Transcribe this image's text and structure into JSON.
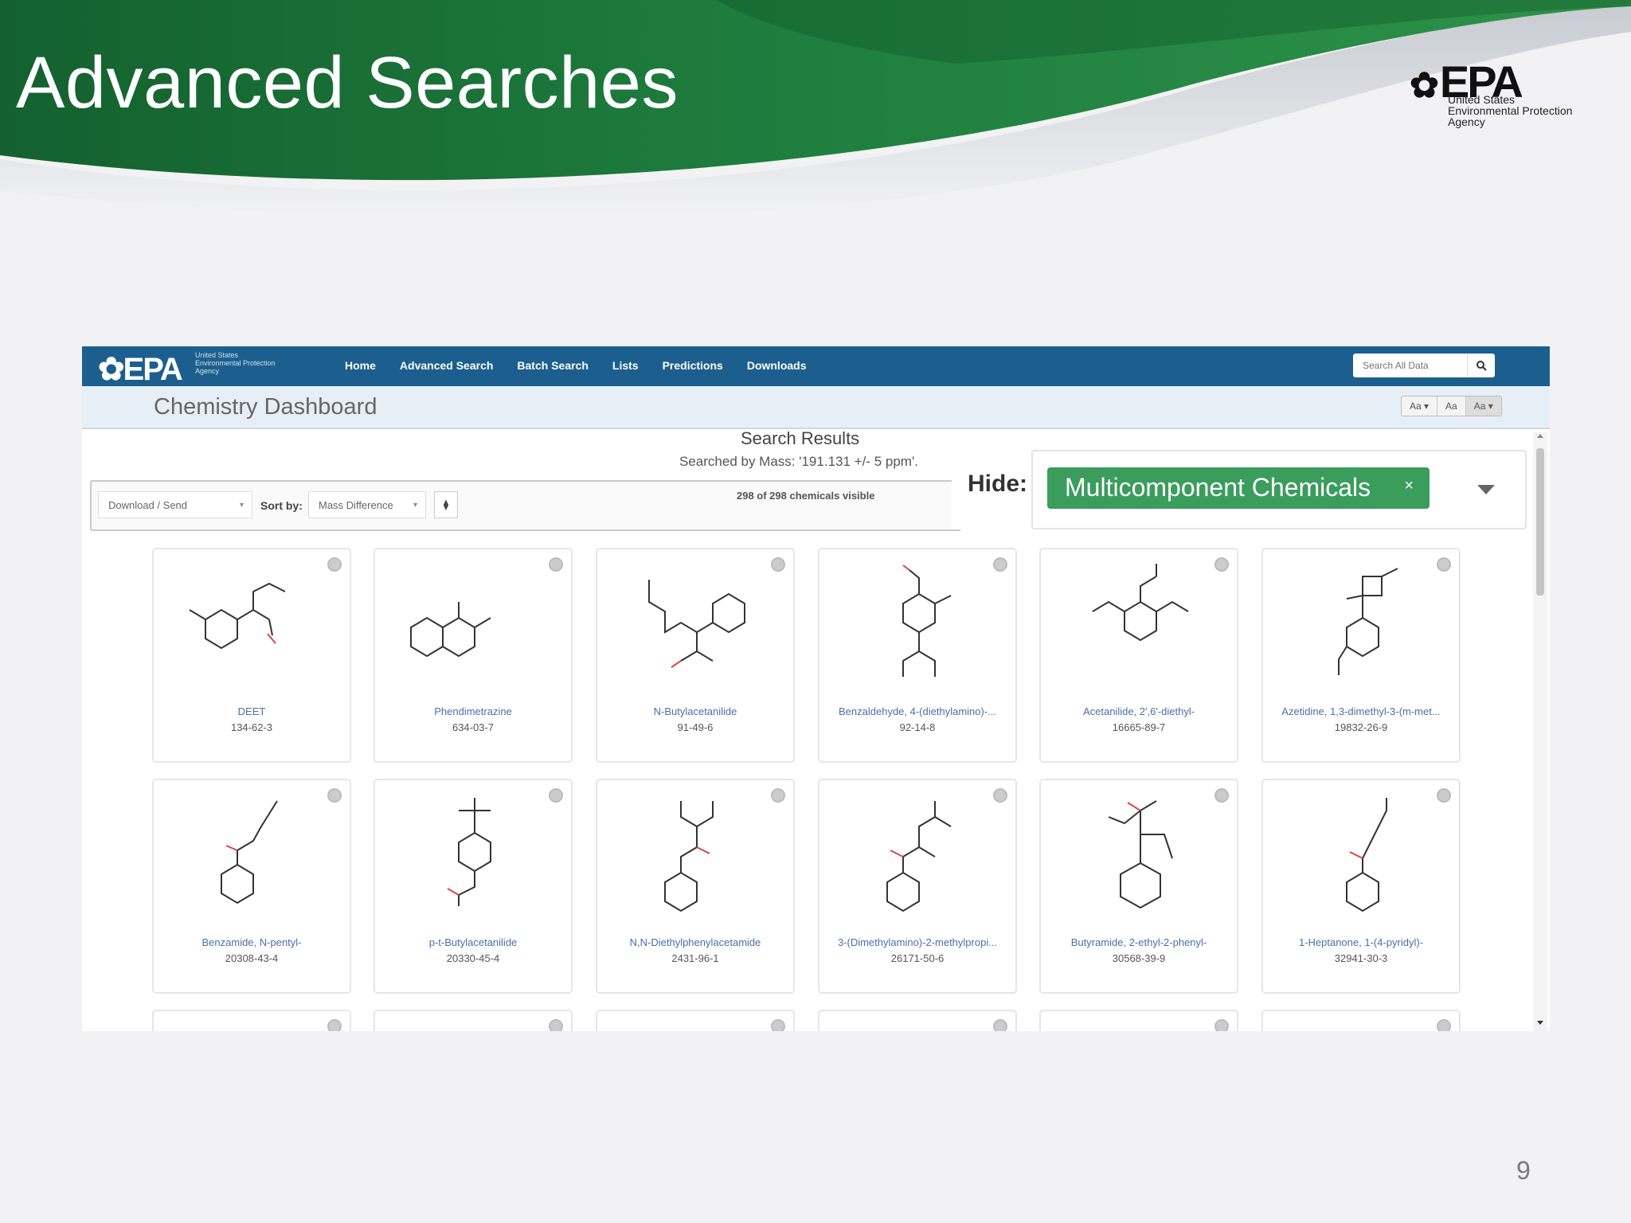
{
  "slide": {
    "title": "Advanced Searches",
    "logo_text": "EPA",
    "logo_agency": "United States\nEnvironmental Protection\nAgency",
    "page_number": "9"
  },
  "app": {
    "brand": "EPA",
    "brand_sub": "United States\nEnvironmental Protection\nAgency",
    "nav_items": [
      "Home",
      "Advanced Search",
      "Batch Search",
      "Lists",
      "Predictions",
      "Downloads"
    ],
    "search_placeholder": "Search All Data",
    "dashboard_title": "Chemistry Dashboard",
    "font_sizes": [
      "Aa ▾",
      "Aa",
      "Aa ▾"
    ]
  },
  "results": {
    "title": "Search Results",
    "subtitle": "Searched by Mass: '191.131 +/- 5 ppm'.",
    "download_label": "Download / Send",
    "sort_label": "Sort by:",
    "sort_value": "Mass Difference",
    "visible_count": "298 of 298 chemicals visible"
  },
  "hide": {
    "label": "Hide:",
    "tag": "Multicomponent Chemicals",
    "tag_remove": "×"
  },
  "chemicals": [
    {
      "name": "DEET",
      "cas": "134-62-3"
    },
    {
      "name": "Phendimetrazine",
      "cas": "634-03-7"
    },
    {
      "name": "N-Butylacetanilide",
      "cas": "91-49-6"
    },
    {
      "name": "Benzaldehyde, 4-(diethylamino)-...",
      "cas": "92-14-8"
    },
    {
      "name": "Acetanilide, 2',6'-diethyl-",
      "cas": "16665-89-7"
    },
    {
      "name": "Azetidine, 1,3-dimethyl-3-(m-met...",
      "cas": "19832-26-9"
    },
    {
      "name": "Benzamide, N-pentyl-",
      "cas": "20308-43-4"
    },
    {
      "name": "p-t-Butylacetanilide",
      "cas": "20330-45-4"
    },
    {
      "name": "N,N-Diethylphenylacetamide",
      "cas": "2431-96-1"
    },
    {
      "name": "3-(Dimethylamino)-2-methylpropi...",
      "cas": "26171-50-6"
    },
    {
      "name": "Butyramide, 2-ethyl-2-phenyl-",
      "cas": "30568-39-9"
    },
    {
      "name": "1-Heptanone, 1-(4-pyridyl)-",
      "cas": "32941-30-3"
    }
  ],
  "colors": {
    "banner_green": "#1e7a3c",
    "nav_blue": "#1c5f8e",
    "tag_green": "#3a9d5c",
    "link_blue": "#4d6ea9"
  }
}
